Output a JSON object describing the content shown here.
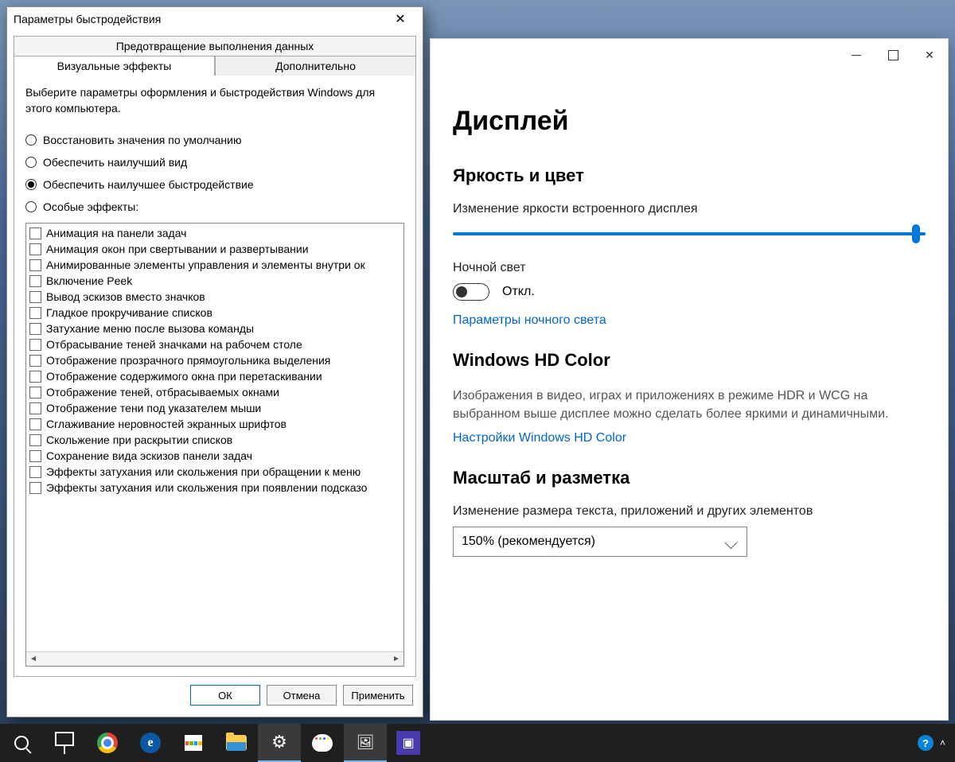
{
  "perf": {
    "title": "Параметры быстродействия",
    "tabs": {
      "dep": "Предотвращение выполнения данных",
      "visual": "Визуальные эффекты",
      "advanced": "Дополнительно"
    },
    "intro": "Выберите параметры оформления и быстродействия Windows для этого компьютера.",
    "radios": {
      "default": "Восстановить значения по умолчанию",
      "bestlook": "Обеспечить наилучший вид",
      "bestperf": "Обеспечить наилучшее быстродействие",
      "custom": "Особые эффекты:"
    },
    "selected_radio": "bestperf",
    "effects": [
      "Анимация на панели задач",
      "Анимация окон при свертывании и развертывании",
      "Анимированные элементы управления и элементы внутри ок",
      "Включение Peek",
      "Вывод эскизов вместо значков",
      "Гладкое прокручивание списков",
      "Затухание меню после вызова команды",
      "Отбрасывание теней значками на рабочем столе",
      "Отображение прозрачного прямоугольника выделения",
      "Отображение содержимого окна при перетаскивании",
      "Отображение теней, отбрасываемых окнами",
      "Отображение тени под указателем мыши",
      "Сглаживание неровностей экранных шрифтов",
      "Скольжение при раскрытии списков",
      "Сохранение вида эскизов панели задач",
      "Эффекты затухания или скольжения при обращении к меню",
      "Эффекты затухания или скольжения при появлении подсказо"
    ],
    "buttons": {
      "ok": "ОК",
      "cancel": "Отмена",
      "apply": "Применить"
    }
  },
  "settings": {
    "heading": "Дисплей",
    "brightness_section": "Яркость и цвет",
    "brightness_label": "Изменение яркости встроенного дисплея",
    "nightlight_label": "Ночной свет",
    "nightlight_state": "Откл.",
    "nightlight_link": "Параметры ночного света",
    "hdcolor_heading": "Windows HD Color",
    "hdcolor_desc": "Изображения в видео, играх и приложениях в режиме HDR и WCG на выбранном выше дисплее можно сделать более яркими и динамичными.",
    "hdcolor_link": "Настройки Windows HD Color",
    "scale_heading": "Масштаб и разметка",
    "scale_label": "Изменение размера текста, приложений и других элементов",
    "scale_value": "150% (рекомендуется)"
  }
}
